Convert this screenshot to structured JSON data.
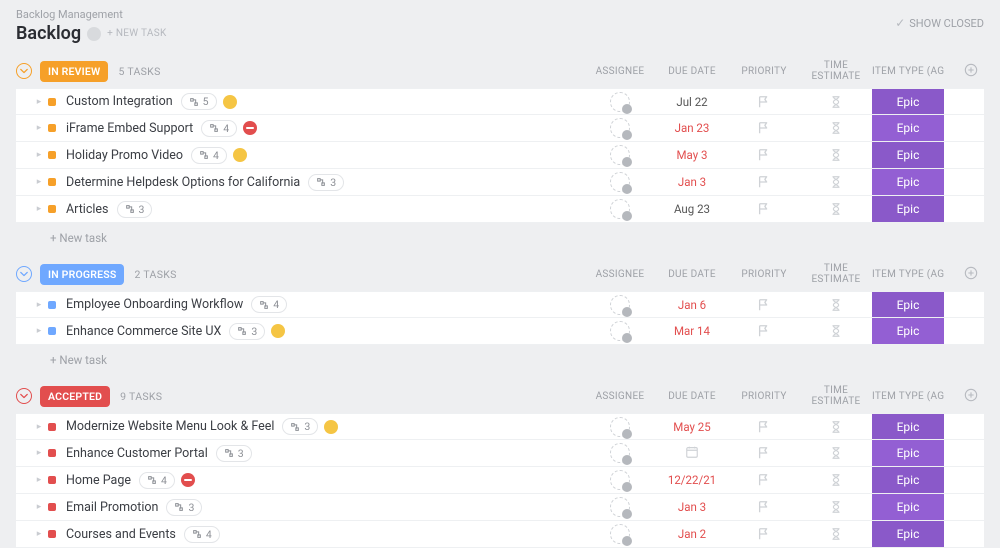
{
  "breadcrumb": "Backlog Management",
  "page_title": "Backlog",
  "new_task_top": "+ NEW TASK",
  "show_closed_label": "SHOW CLOSED",
  "columns": {
    "assignee": "ASSIGNEE",
    "due": "DUE DATE",
    "priority": "PRIORITY",
    "time": "TIME ESTIMATE",
    "item": "ITEM TYPE (AGIL..."
  },
  "new_task_row": "+ New task",
  "sections": [
    {
      "status_label": "IN REVIEW",
      "status_color": "#f6a029",
      "task_count_label": "5 TASKS",
      "tasks": [
        {
          "name": "Custom Integration",
          "subtasks": "5",
          "tags": [
            "yellow"
          ],
          "due": "Jul 22",
          "overdue": false,
          "item": "Epic"
        },
        {
          "name": "iFrame Embed Support",
          "subtasks": "4",
          "tags": [
            "red"
          ],
          "due": "Jan 23",
          "overdue": true,
          "item": "Epic"
        },
        {
          "name": "Holiday Promo Video",
          "subtasks": "4",
          "tags": [
            "yellow"
          ],
          "due": "May 3",
          "overdue": true,
          "item": "Epic"
        },
        {
          "name": "Determine Helpdesk Options for California",
          "subtasks": "3",
          "tags": [],
          "due": "Jan 3",
          "overdue": true,
          "item": "Epic"
        },
        {
          "name": "Articles",
          "subtasks": "3",
          "tags": [],
          "due": "Aug 23",
          "overdue": false,
          "item": "Epic"
        }
      ]
    },
    {
      "status_label": "IN PROGRESS",
      "status_color": "#6fa8ff",
      "task_count_label": "2 TASKS",
      "tasks": [
        {
          "name": "Employee Onboarding Workflow",
          "subtasks": "4",
          "tags": [],
          "due": "Jan 6",
          "overdue": true,
          "item": "Epic"
        },
        {
          "name": "Enhance Commerce Site UX",
          "subtasks": "3",
          "tags": [
            "yellow"
          ],
          "due": "Mar 14",
          "overdue": true,
          "item": "Epic"
        }
      ]
    },
    {
      "status_label": "ACCEPTED",
      "status_color": "#e24e4e",
      "task_count_label": "9 TASKS",
      "tasks": [
        {
          "name": "Modernize Website Menu Look & Feel",
          "subtasks": "3",
          "tags": [
            "yellow"
          ],
          "due": "May 25",
          "overdue": true,
          "item": "Epic"
        },
        {
          "name": "Enhance Customer Portal",
          "subtasks": "3",
          "tags": [],
          "due": "calendar",
          "overdue": false,
          "item": "Epic"
        },
        {
          "name": "Home Page",
          "subtasks": "4",
          "tags": [
            "red"
          ],
          "due": "12/22/21",
          "overdue": true,
          "item": "Epic"
        },
        {
          "name": "Email Promotion",
          "subtasks": "3",
          "tags": [],
          "due": "Jan 3",
          "overdue": true,
          "item": "Epic"
        },
        {
          "name": "Courses and Events",
          "subtasks": "4",
          "tags": [],
          "due": "Jan 2",
          "overdue": true,
          "item": "Epic"
        }
      ]
    }
  ]
}
